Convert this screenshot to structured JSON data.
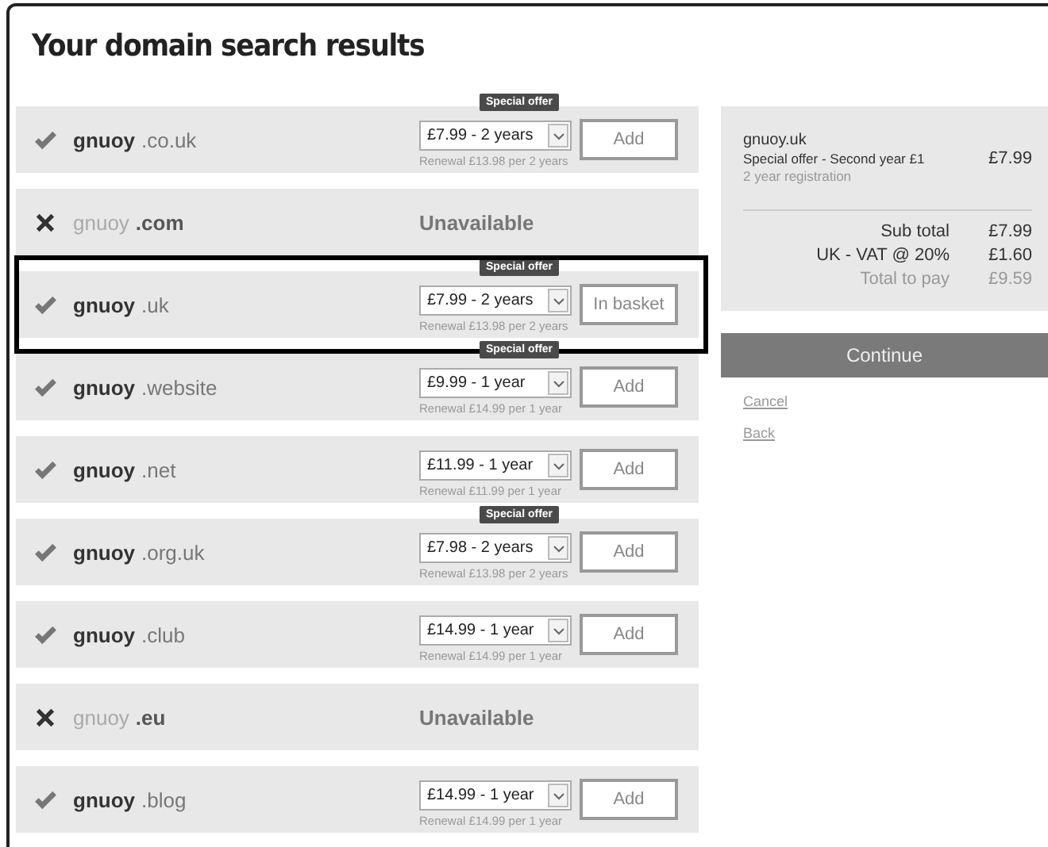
{
  "title": "Your domain search results",
  "results": [
    {
      "kind": "available",
      "name": "gnuoy",
      "tld": ".co.uk",
      "offer": "Special offer",
      "price": "£7.99 - 2 years",
      "renewal": "Renewal £13.98 per 2 years",
      "action": "Add",
      "selected": false
    },
    {
      "kind": "unavailable",
      "name": "gnuoy",
      "tld": ".com",
      "status": "Unavailable",
      "selected": false
    },
    {
      "kind": "available",
      "name": "gnuoy",
      "tld": ".uk",
      "offer": "Special offer",
      "price": "£7.99 - 2 years",
      "renewal": "Renewal £13.98 per 2 years",
      "action": "In basket",
      "selected": true
    },
    {
      "kind": "available",
      "name": "gnuoy",
      "tld": ".website",
      "offer": "Special offer",
      "price": "£9.99 - 1 year",
      "renewal": "Renewal £14.99 per 1 year",
      "action": "Add",
      "selected": false
    },
    {
      "kind": "available",
      "name": "gnuoy",
      "tld": ".net",
      "price": "£11.99 - 1 year",
      "renewal": "Renewal £11.99 per 1 year",
      "action": "Add",
      "selected": false
    },
    {
      "kind": "available",
      "name": "gnuoy",
      "tld": ".org.uk",
      "offer": "Special offer",
      "price": "£7.98 - 2 years",
      "renewal": "Renewal £13.98 per 2 years",
      "action": "Add",
      "selected": false
    },
    {
      "kind": "available",
      "name": "gnuoy",
      "tld": ".club",
      "price": "£14.99 - 1 year",
      "renewal": "Renewal £14.99 per 1 year",
      "action": "Add",
      "selected": false
    },
    {
      "kind": "unavailable",
      "name": "gnuoy",
      "tld": ".eu",
      "status": "Unavailable",
      "selected": false
    },
    {
      "kind": "available",
      "name": "gnuoy",
      "tld": ".blog",
      "price": "£14.99 - 1 year",
      "renewal": "Renewal £14.99 per 1 year",
      "action": "Add",
      "selected": false
    }
  ],
  "basket": {
    "item": "gnuoy.uk",
    "offer": "Special offer - Second year £1",
    "price": "£7.99",
    "term": "2 year registration",
    "totals": [
      {
        "kind": "normal",
        "label": "Sub total",
        "value": "£7.99"
      },
      {
        "kind": "normal",
        "label": "UK - VAT @ 20%",
        "value": "£1.60"
      },
      {
        "kind": "muted",
        "label": "Total to pay",
        "value": "£9.59"
      }
    ]
  },
  "continue": "Continue",
  "links": [
    "Cancel",
    "Back"
  ]
}
